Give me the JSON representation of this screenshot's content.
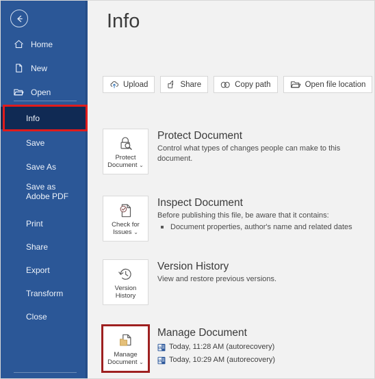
{
  "app": {
    "accent_blue": "#2b5797",
    "active_nav_bg": "#102a54",
    "highlight_red": "#e01b1b",
    "page_bg": "#f2f2f2"
  },
  "sidebar": {
    "back_label": "Back",
    "back_icon": "back-arrow-circle-icon",
    "items": [
      {
        "label": "Home",
        "icon": "home-icon",
        "active": false
      },
      {
        "label": "New",
        "icon": "page-icon",
        "active": false
      },
      {
        "label": "Open",
        "icon": "folder-icon",
        "active": false
      },
      {
        "label": "Info",
        "icon": "",
        "active": true
      },
      {
        "label": "Save",
        "icon": "",
        "active": false
      },
      {
        "label": "Save As",
        "icon": "",
        "active": false
      },
      {
        "label": "Save as Adobe PDF",
        "icon": "",
        "active": false
      },
      {
        "label": "Print",
        "icon": "",
        "active": false
      },
      {
        "label": "Share",
        "icon": "",
        "active": false
      },
      {
        "label": "Export",
        "icon": "",
        "active": false
      },
      {
        "label": "Transform",
        "icon": "",
        "active": false
      },
      {
        "label": "Close",
        "icon": "",
        "active": false
      }
    ]
  },
  "header": {
    "title": "Info"
  },
  "toolbar": {
    "buttons": [
      {
        "label": "Upload",
        "icon": "cloud-upload-icon"
      },
      {
        "label": "Share",
        "icon": "share-icon"
      },
      {
        "label": "Copy path",
        "icon": "link-icon"
      },
      {
        "label": "Open file location",
        "icon": "open-folder-icon"
      }
    ]
  },
  "sections": {
    "protect": {
      "tile_label_line1": "Protect",
      "tile_label_line2": "Document",
      "tile_chevron": "⌄",
      "tile_icon": "padlock-magnifier-icon",
      "title": "Protect Document",
      "desc": "Control what types of changes people can make to this document."
    },
    "inspect": {
      "tile_label_line1": "Check for",
      "tile_label_line2": "Issues",
      "tile_chevron": "⌄",
      "tile_icon": "document-check-icon",
      "title": "Inspect Document",
      "desc": "Before publishing this file, be aware that it contains:",
      "bullets": [
        "Document properties, author's name and related dates"
      ]
    },
    "version": {
      "tile_label_line1": "Version",
      "tile_label_line2": "History",
      "tile_chevron": "",
      "tile_icon": "clock-back-icon",
      "title": "Version History",
      "desc": "View and restore previous versions."
    },
    "manage": {
      "tile_label_line1": "Manage",
      "tile_label_line2": "Document",
      "tile_chevron": "⌄",
      "tile_icon": "document-folder-icon",
      "title": "Manage Document",
      "versions": [
        {
          "label": "Today, 11:28 AM (autorecovery)",
          "icon": "word-doc-icon"
        },
        {
          "label": "Today, 10:29 AM (autorecovery)",
          "icon": "word-doc-icon"
        }
      ]
    }
  },
  "annotations": {
    "info_highlight": "red-rectangle-highlight",
    "manage_highlight": "red-rectangle-highlight"
  }
}
